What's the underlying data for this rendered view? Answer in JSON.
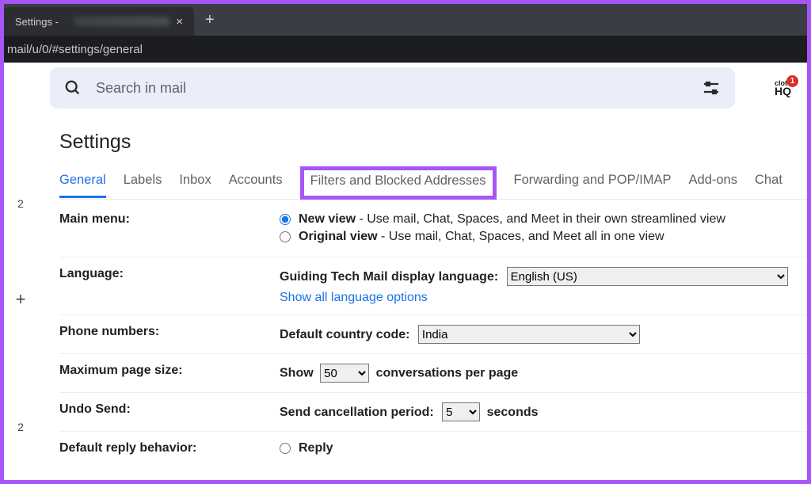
{
  "browser": {
    "tab_title": "Settings -",
    "url": "mail/u/0/#settings/general"
  },
  "search": {
    "placeholder": "Search in mail"
  },
  "badge": {
    "top": "clot",
    "bottom": "HQ",
    "count": "1"
  },
  "page_title": "Settings",
  "tabs": {
    "general": "General",
    "labels": "Labels",
    "inbox": "Inbox",
    "accounts": "Accounts",
    "filters": "Filters and Blocked Addresses",
    "forwarding": "Forwarding and POP/IMAP",
    "addons": "Add-ons",
    "chat": "Chat"
  },
  "rail": {
    "n1": "2",
    "plus": "+",
    "n2": "2"
  },
  "main_menu": {
    "label": "Main menu:",
    "new_view": "New view",
    "new_view_desc": " - Use mail, Chat, Spaces, and Meet in their own streamlined view",
    "orig_view": "Original view",
    "orig_view_desc": " - Use mail, Chat, Spaces, and Meet all in one view"
  },
  "language": {
    "label": "Language:",
    "inline": "Guiding Tech Mail display language:",
    "value": "English (US)",
    "show_all": "Show all language options"
  },
  "phone": {
    "label": "Phone numbers:",
    "inline": "Default country code:",
    "value": "India"
  },
  "page_size": {
    "label": "Maximum page size:",
    "show": "Show",
    "value": "50",
    "per": "conversations per page"
  },
  "undo": {
    "label": "Undo Send:",
    "inline": "Send cancellation period:",
    "value": "5",
    "unit": "seconds"
  },
  "reply": {
    "label": "Default reply behavior:",
    "option": "Reply"
  }
}
